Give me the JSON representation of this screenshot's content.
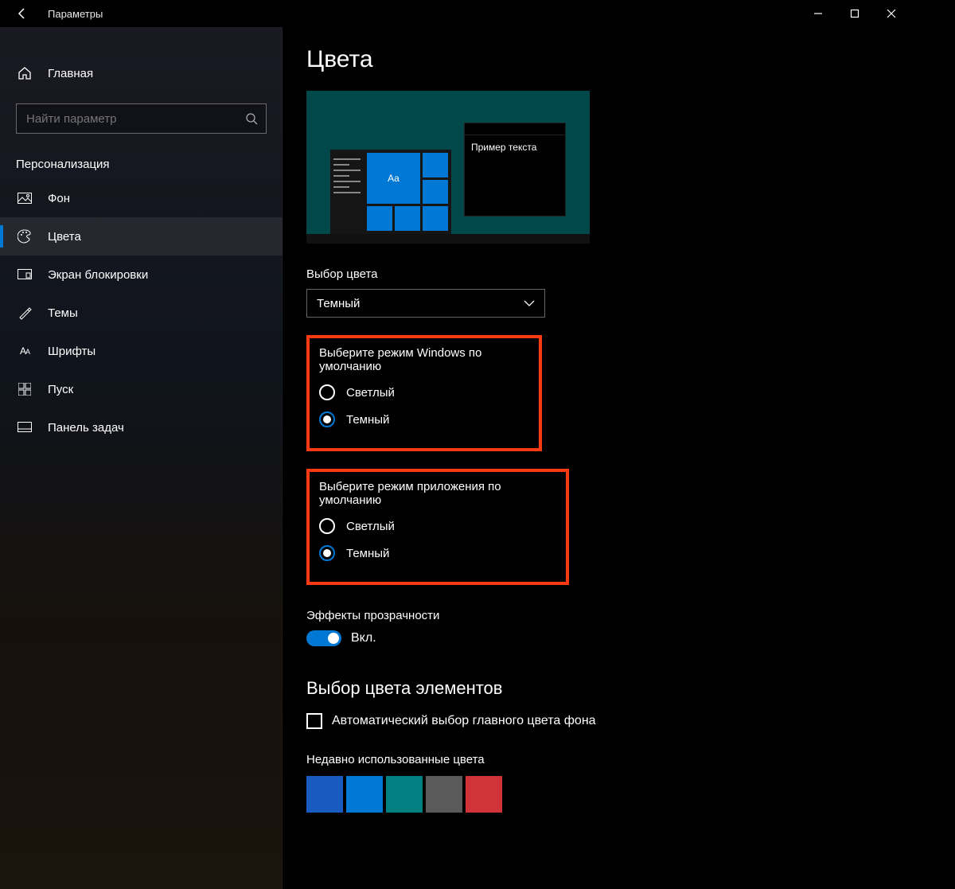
{
  "window": {
    "title": "Параметры"
  },
  "sidebar": {
    "home": "Главная",
    "search_placeholder": "Найти параметр",
    "section": "Персонализация",
    "items": [
      {
        "label": "Фон"
      },
      {
        "label": "Цвета"
      },
      {
        "label": "Экран блокировки"
      },
      {
        "label": "Темы"
      },
      {
        "label": "Шрифты"
      },
      {
        "label": "Пуск"
      },
      {
        "label": "Панель задач"
      }
    ]
  },
  "main": {
    "title": "Цвета",
    "preview_sample_text": "Пример текста",
    "preview_tile_text": "Aa",
    "choose_color_label": "Выбор цвета",
    "choose_color_value": "Темный",
    "group_windows": {
      "label": "Выберите режим Windows по умолчанию",
      "light": "Светлый",
      "dark": "Темный"
    },
    "group_app": {
      "label": "Выберите режим приложения по умолчанию",
      "light": "Светлый",
      "dark": "Темный"
    },
    "transparency_label": "Эффекты прозрачности",
    "transparency_state": "Вкл.",
    "accent_title": "Выбор цвета элементов",
    "auto_pick_label": "Автоматический выбор главного цвета фона",
    "recent_label": "Недавно использованные цвета",
    "recent_colors": [
      "#185abd",
      "#0078d4",
      "#008080",
      "#5a5a5a",
      "#d13438"
    ]
  }
}
